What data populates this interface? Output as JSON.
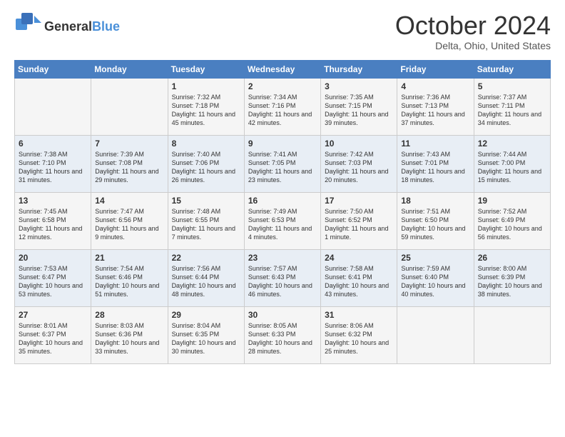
{
  "logo": {
    "general": "General",
    "blue": "Blue"
  },
  "title": "October 2024",
  "location": "Delta, Ohio, United States",
  "days_of_week": [
    "Sunday",
    "Monday",
    "Tuesday",
    "Wednesday",
    "Thursday",
    "Friday",
    "Saturday"
  ],
  "weeks": [
    [
      {
        "day": "",
        "info": ""
      },
      {
        "day": "",
        "info": ""
      },
      {
        "day": "1",
        "info": "Sunrise: 7:32 AM\nSunset: 7:18 PM\nDaylight: 11 hours and 45 minutes."
      },
      {
        "day": "2",
        "info": "Sunrise: 7:34 AM\nSunset: 7:16 PM\nDaylight: 11 hours and 42 minutes."
      },
      {
        "day": "3",
        "info": "Sunrise: 7:35 AM\nSunset: 7:15 PM\nDaylight: 11 hours and 39 minutes."
      },
      {
        "day": "4",
        "info": "Sunrise: 7:36 AM\nSunset: 7:13 PM\nDaylight: 11 hours and 37 minutes."
      },
      {
        "day": "5",
        "info": "Sunrise: 7:37 AM\nSunset: 7:11 PM\nDaylight: 11 hours and 34 minutes."
      }
    ],
    [
      {
        "day": "6",
        "info": "Sunrise: 7:38 AM\nSunset: 7:10 PM\nDaylight: 11 hours and 31 minutes."
      },
      {
        "day": "7",
        "info": "Sunrise: 7:39 AM\nSunset: 7:08 PM\nDaylight: 11 hours and 29 minutes."
      },
      {
        "day": "8",
        "info": "Sunrise: 7:40 AM\nSunset: 7:06 PM\nDaylight: 11 hours and 26 minutes."
      },
      {
        "day": "9",
        "info": "Sunrise: 7:41 AM\nSunset: 7:05 PM\nDaylight: 11 hours and 23 minutes."
      },
      {
        "day": "10",
        "info": "Sunrise: 7:42 AM\nSunset: 7:03 PM\nDaylight: 11 hours and 20 minutes."
      },
      {
        "day": "11",
        "info": "Sunrise: 7:43 AM\nSunset: 7:01 PM\nDaylight: 11 hours and 18 minutes."
      },
      {
        "day": "12",
        "info": "Sunrise: 7:44 AM\nSunset: 7:00 PM\nDaylight: 11 hours and 15 minutes."
      }
    ],
    [
      {
        "day": "13",
        "info": "Sunrise: 7:45 AM\nSunset: 6:58 PM\nDaylight: 11 hours and 12 minutes."
      },
      {
        "day": "14",
        "info": "Sunrise: 7:47 AM\nSunset: 6:56 PM\nDaylight: 11 hours and 9 minutes."
      },
      {
        "day": "15",
        "info": "Sunrise: 7:48 AM\nSunset: 6:55 PM\nDaylight: 11 hours and 7 minutes."
      },
      {
        "day": "16",
        "info": "Sunrise: 7:49 AM\nSunset: 6:53 PM\nDaylight: 11 hours and 4 minutes."
      },
      {
        "day": "17",
        "info": "Sunrise: 7:50 AM\nSunset: 6:52 PM\nDaylight: 11 hours and 1 minute."
      },
      {
        "day": "18",
        "info": "Sunrise: 7:51 AM\nSunset: 6:50 PM\nDaylight: 10 hours and 59 minutes."
      },
      {
        "day": "19",
        "info": "Sunrise: 7:52 AM\nSunset: 6:49 PM\nDaylight: 10 hours and 56 minutes."
      }
    ],
    [
      {
        "day": "20",
        "info": "Sunrise: 7:53 AM\nSunset: 6:47 PM\nDaylight: 10 hours and 53 minutes."
      },
      {
        "day": "21",
        "info": "Sunrise: 7:54 AM\nSunset: 6:46 PM\nDaylight: 10 hours and 51 minutes."
      },
      {
        "day": "22",
        "info": "Sunrise: 7:56 AM\nSunset: 6:44 PM\nDaylight: 10 hours and 48 minutes."
      },
      {
        "day": "23",
        "info": "Sunrise: 7:57 AM\nSunset: 6:43 PM\nDaylight: 10 hours and 46 minutes."
      },
      {
        "day": "24",
        "info": "Sunrise: 7:58 AM\nSunset: 6:41 PM\nDaylight: 10 hours and 43 minutes."
      },
      {
        "day": "25",
        "info": "Sunrise: 7:59 AM\nSunset: 6:40 PM\nDaylight: 10 hours and 40 minutes."
      },
      {
        "day": "26",
        "info": "Sunrise: 8:00 AM\nSunset: 6:39 PM\nDaylight: 10 hours and 38 minutes."
      }
    ],
    [
      {
        "day": "27",
        "info": "Sunrise: 8:01 AM\nSunset: 6:37 PM\nDaylight: 10 hours and 35 minutes."
      },
      {
        "day": "28",
        "info": "Sunrise: 8:03 AM\nSunset: 6:36 PM\nDaylight: 10 hours and 33 minutes."
      },
      {
        "day": "29",
        "info": "Sunrise: 8:04 AM\nSunset: 6:35 PM\nDaylight: 10 hours and 30 minutes."
      },
      {
        "day": "30",
        "info": "Sunrise: 8:05 AM\nSunset: 6:33 PM\nDaylight: 10 hours and 28 minutes."
      },
      {
        "day": "31",
        "info": "Sunrise: 8:06 AM\nSunset: 6:32 PM\nDaylight: 10 hours and 25 minutes."
      },
      {
        "day": "",
        "info": ""
      },
      {
        "day": "",
        "info": ""
      }
    ]
  ]
}
